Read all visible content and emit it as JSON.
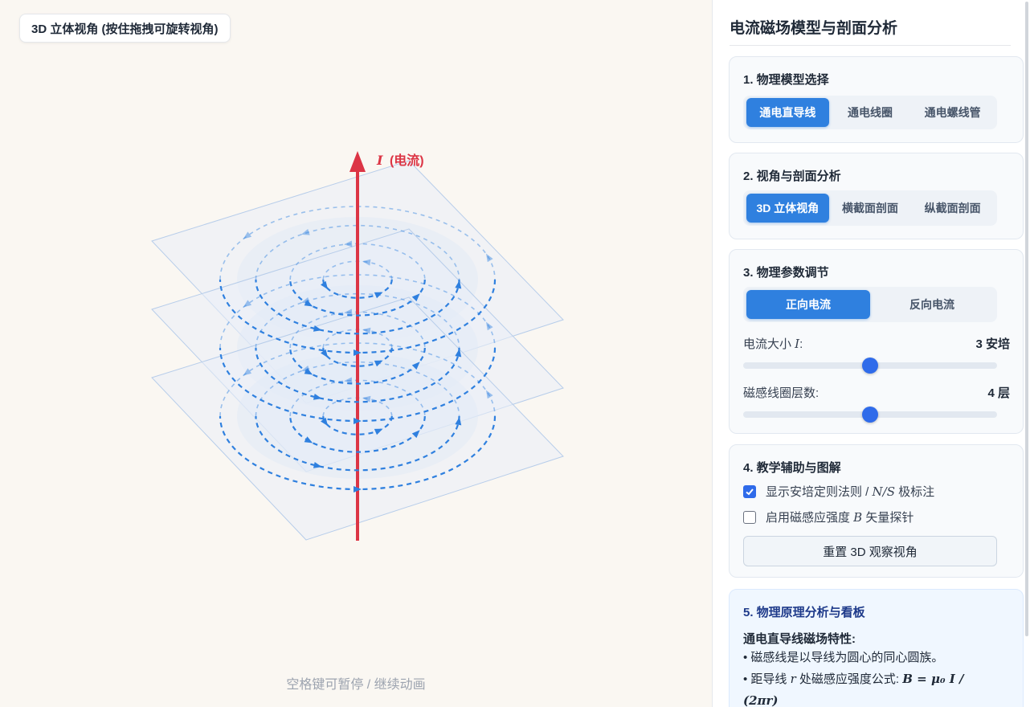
{
  "stage": {
    "view_badge": "3D 立体视角 (按住拖拽可旋转视角)",
    "current_symbol": "I",
    "current_label": "(电流)",
    "hint": "空格键可暂停 / 继续动画"
  },
  "colors": {
    "accent": "#2f80df",
    "current": "#dc3545",
    "field_line": "#2f80df",
    "plane": "#e9eff8"
  },
  "panel": {
    "title": "电流磁场模型与剖面分析",
    "model": {
      "title": "1. 物理模型选择",
      "options": [
        "通电直导线",
        "通电线圈",
        "通电螺线管"
      ],
      "selected": "通电直导线"
    },
    "view": {
      "title": "2. 视角与剖面分析",
      "options": [
        "3D 立体视角",
        "横截面剖面",
        "纵截面剖面"
      ],
      "selected": "3D 立体视角"
    },
    "params": {
      "title": "3. 物理参数调节",
      "direction_options": [
        "正向电流",
        "反向电流"
      ],
      "direction_selected": "正向电流",
      "current_label_prefix": "电流大小 ",
      "current_label_symbol": "I",
      "current_label_suffix": ":",
      "current_value": "3 安培",
      "current_level": 0.5,
      "layers_label": "磁感线圈层数:",
      "layers_value": "4 层",
      "layers_level": 0.5
    },
    "teaching": {
      "title": "4. 教学辅助与图解",
      "opt1_prefix": "显示安培定则法则 / ",
      "opt1_symbol": "N/S",
      "opt1_suffix": " 极标注",
      "opt1_checked": true,
      "opt2_prefix": "启用磁感应强度 ",
      "opt2_symbol": "B",
      "opt2_suffix": " 矢量探针",
      "opt2_checked": false,
      "reset_label": "重置 3D 观察视角"
    },
    "analysis": {
      "title": "5. 物理原理分析与看板",
      "subtitle": "通电直导线磁场特性:",
      "line1": "• 磁感线是以导线为圆心的同心圆族。",
      "line2_prefix": "• 距导线 ",
      "line2_symbol": "r",
      "line2_middle": " 处磁感应强度公式: ",
      "line2_formula": "B = μ₀ I / (2πr)"
    }
  }
}
